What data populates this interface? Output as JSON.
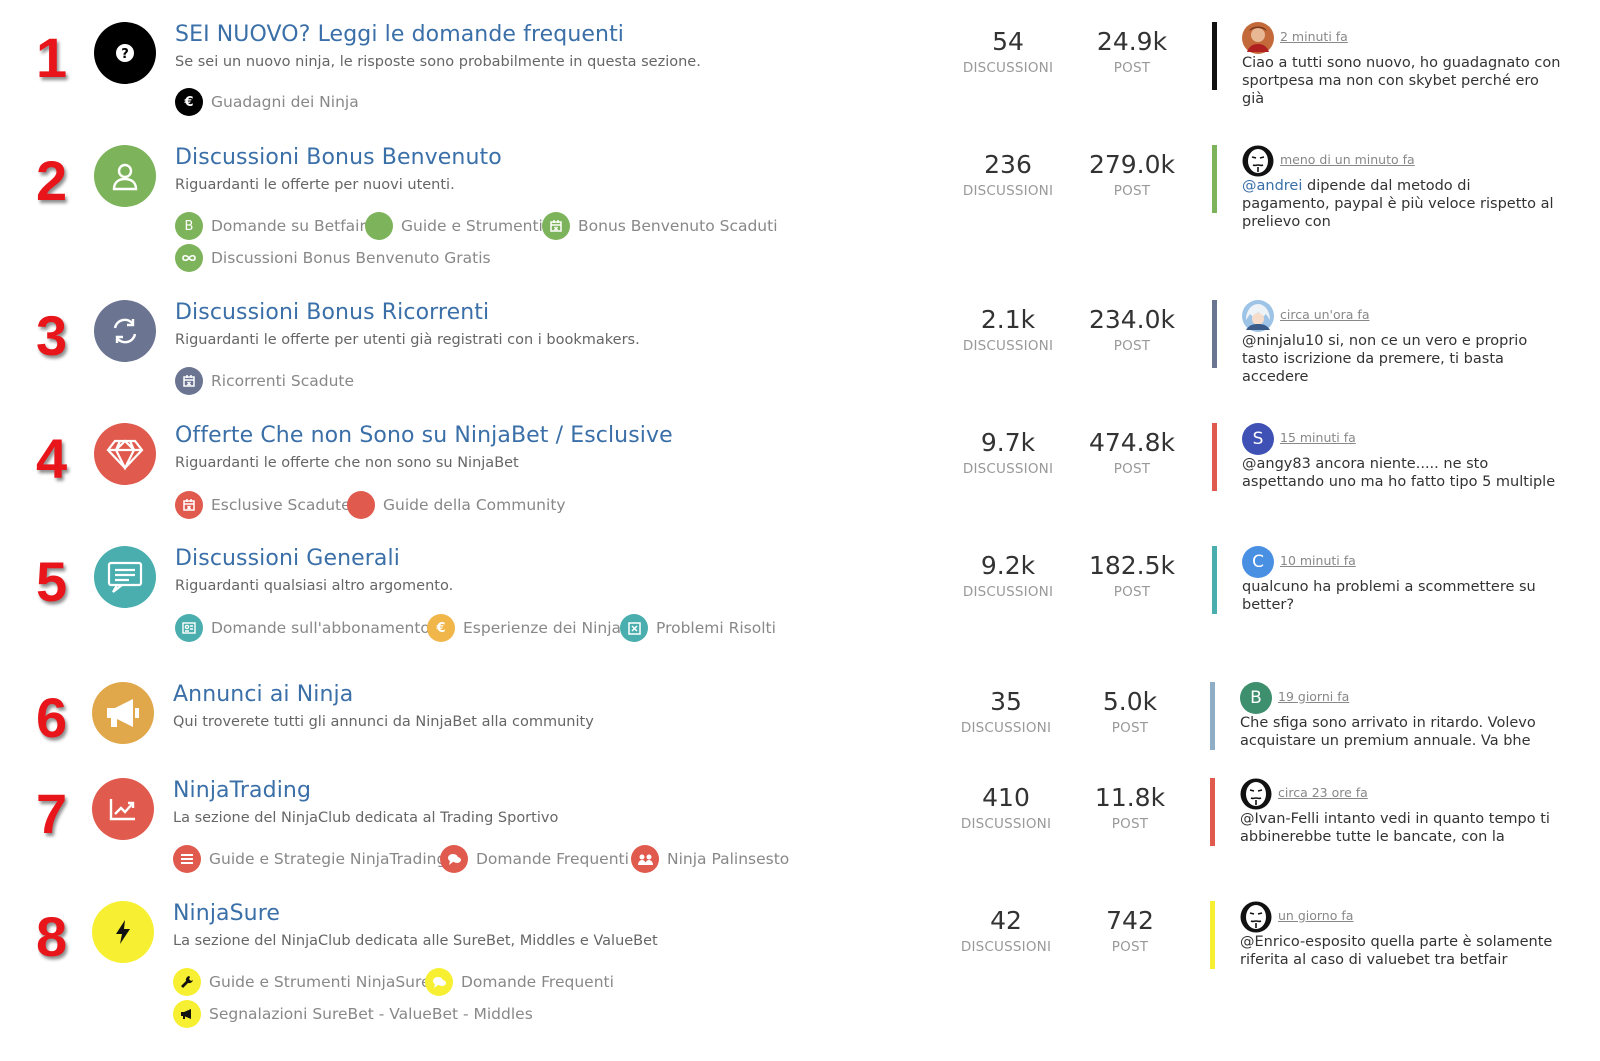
{
  "categories": [
    {
      "rank": "1",
      "icon": "question-icon",
      "icon_color": "#000000",
      "title": "SEI NUOVO? Leggi le domande frequenti",
      "description": "Se sei un nuovo ninja, le risposte sono probabilmente in questa sezione.",
      "subcategories": [
        {
          "label": "Guadagni dei Ninja",
          "icon": "euro-icon",
          "color": "#000000"
        }
      ],
      "discussions": "54",
      "discussions_label": "DISCUSSIONI",
      "posts": "24.9k",
      "posts_label": "POST",
      "accent": "#111111",
      "latest": {
        "time": "2 minuti fa",
        "avatar": "user-photo-avatar",
        "mention": "",
        "text": "Ciao a tutti sono nuovo, ho guadagnato con sportpesa ma non con skybet perché ero già"
      }
    },
    {
      "rank": "2",
      "icon": "user-icon",
      "icon_color": "#7db35a",
      "title": "Discussioni Bonus Benvenuto",
      "description": "Riguardanti le offerte per nuovi utenti.",
      "subcategories": [
        {
          "label": "Domande su Betfair",
          "icon": "letter-b-icon",
          "glyph": "B",
          "color": "#7db35a"
        },
        {
          "label": "Guide e Strumenti",
          "icon": "dot-icon",
          "color": "#7db35a"
        },
        {
          "label": "Bonus Benvenuto Scaduti",
          "icon": "calendar-x-icon",
          "color": "#7db35a"
        },
        {
          "label": "Discussioni Bonus Benvenuto Gratis",
          "icon": "infinity-icon",
          "color": "#7db35a"
        }
      ],
      "discussions": "236",
      "discussions_label": "DISCUSSIONI",
      "posts": "279.0k",
      "posts_label": "POST",
      "accent": "#7db35a",
      "latest": {
        "time": "meno di un minuto fa",
        "avatar": "anonymous-mask-avatar",
        "mention": "@andrei",
        "text": " dipende dal metodo di pagamento, paypal è più veloce rispetto al prelievo con"
      }
    },
    {
      "rank": "3",
      "icon": "refresh-icon",
      "icon_color": "#6b7591",
      "title": "Discussioni Bonus Ricorrenti",
      "description": "Riguardanti le offerte per utenti già registrati con i bookmakers.",
      "subcategories": [
        {
          "label": "Ricorrenti Scadute",
          "icon": "calendar-x-icon",
          "color": "#6b7591"
        }
      ],
      "discussions": "2.1k",
      "discussions_label": "DISCUSSIONI",
      "posts": "234.0k",
      "posts_label": "POST",
      "accent": "#6b7591",
      "latest": {
        "time": "circa un'ora fa",
        "avatar": "anime-avatar",
        "mention": "",
        "text": "@ninjalu10 si, non ce un vero e proprio tasto iscrizione da premere, ti basta accedere"
      }
    },
    {
      "rank": "4",
      "icon": "diamond-icon",
      "icon_color": "#e05a4e",
      "title": "Offerte Che non Sono su NinjaBet / Esclusive",
      "description": "Riguardanti le offerte che non sono su NinjaBet",
      "subcategories": [
        {
          "label": "Esclusive Scadute",
          "icon": "calendar-x-icon",
          "color": "#e05a4e"
        },
        {
          "label": "Guide della Community",
          "icon": "dot-icon",
          "color": "#e05a4e"
        }
      ],
      "discussions": "9.7k",
      "discussions_label": "DISCUSSIONI",
      "posts": "474.8k",
      "posts_label": "POST",
      "accent": "#e05a4e",
      "latest": {
        "time": "15 minuti fa",
        "avatar": "letter-s-avatar",
        "avatar_letter": "S",
        "avatar_color": "#3f51b5",
        "mention": "",
        "text": "@angy83 ancora niente..... ne sto aspettando uno ma ho fatto tipo 5 multiple"
      }
    },
    {
      "rank": "5",
      "icon": "chat-icon",
      "icon_color": "#4aaeae",
      "title": "Discussioni Generali",
      "description": "Riguardanti qualsiasi altro argomento.",
      "subcategories": [
        {
          "label": "Domande sull'abbonamento",
          "icon": "id-card-icon",
          "color": "#4aaeae"
        },
        {
          "label": "Esperienze dei Ninja",
          "icon": "euro-icon",
          "color": "#f0b64a"
        },
        {
          "label": "Problemi Risolti",
          "icon": "x-box-icon",
          "color": "#4aaeae"
        }
      ],
      "discussions": "9.2k",
      "discussions_label": "DISCUSSIONI",
      "posts": "182.5k",
      "posts_label": "POST",
      "accent": "#4aaeae",
      "latest": {
        "time": "10 minuti fa",
        "avatar": "letter-c-avatar",
        "avatar_letter": "C",
        "avatar_color": "#4a90e2",
        "mention": "",
        "text": "qualcuno ha problemi a scommettere su better?"
      }
    },
    {
      "rank": "6",
      "icon": "megaphone-icon",
      "icon_color": "#e0a84a",
      "title": "Annunci ai Ninja",
      "description": "Qui troverete tutti gli annunci da NinjaBet alla community",
      "subcategories": [],
      "discussions": "35",
      "discussions_label": "DISCUSSIONI",
      "posts": "5.0k",
      "posts_label": "POST",
      "accent": "#8fadc4",
      "latest": {
        "time": "19 giorni fa",
        "avatar": "letter-b-avatar",
        "avatar_letter": "B",
        "avatar_color": "#3d8f6e",
        "mention": "",
        "text": "Che sfiga sono arrivato in ritardo. Volevo acquistare un premium annuale. Va bhe"
      }
    },
    {
      "rank": "7",
      "icon": "trending-up-icon",
      "icon_color": "#e05a4e",
      "title": "NinjaTrading",
      "description": "La sezione del NinjaClub dedicata al Trading Sportivo",
      "subcategories": [
        {
          "label": "Guide e Strategie NinjaTrading",
          "icon": "list-icon",
          "color": "#e05a4e"
        },
        {
          "label": "Domande Frequenti",
          "icon": "comments-icon",
          "color": "#e05a4e"
        },
        {
          "label": "Ninja Palinsesto",
          "icon": "users-icon",
          "color": "#e05a4e"
        }
      ],
      "discussions": "410",
      "discussions_label": "DISCUSSIONI",
      "posts": "11.8k",
      "posts_label": "POST",
      "accent": "#e05a4e",
      "latest": {
        "time": "circa 23 ore fa",
        "avatar": "anonymous-mask-avatar",
        "mention": "",
        "text": "@Ivan-Felli intanto vedi in quanto tempo ti abbinerebbe tutte le bancate, con la"
      }
    },
    {
      "rank": "8",
      "icon": "bolt-icon",
      "icon_color": "#f7f032",
      "title": "NinjaSure",
      "description": "La sezione del NinjaClub dedicata alle SureBet, Middles e ValueBet",
      "subcategories": [
        {
          "label": "Guide e Strumenti NinjaSure",
          "icon": "wrench-icon",
          "color": "#f7f032"
        },
        {
          "label": "Domande Frequenti",
          "icon": "comments-icon",
          "color": "#f7f032"
        },
        {
          "label": "Segnalazioni SureBet - ValueBet - Middles",
          "icon": "megaphone-icon",
          "color": "#f7f032"
        }
      ],
      "discussions": "42",
      "discussions_label": "DISCUSSIONI",
      "posts": "742",
      "posts_label": "POST",
      "accent": "#f7f032",
      "latest": {
        "time": "un giorno fa",
        "avatar": "anonymous-mask-avatar",
        "mention": "",
        "text": "@Enrico-esposito quella parte è solamente riferita al caso di valuebet tra betfair"
      }
    }
  ]
}
